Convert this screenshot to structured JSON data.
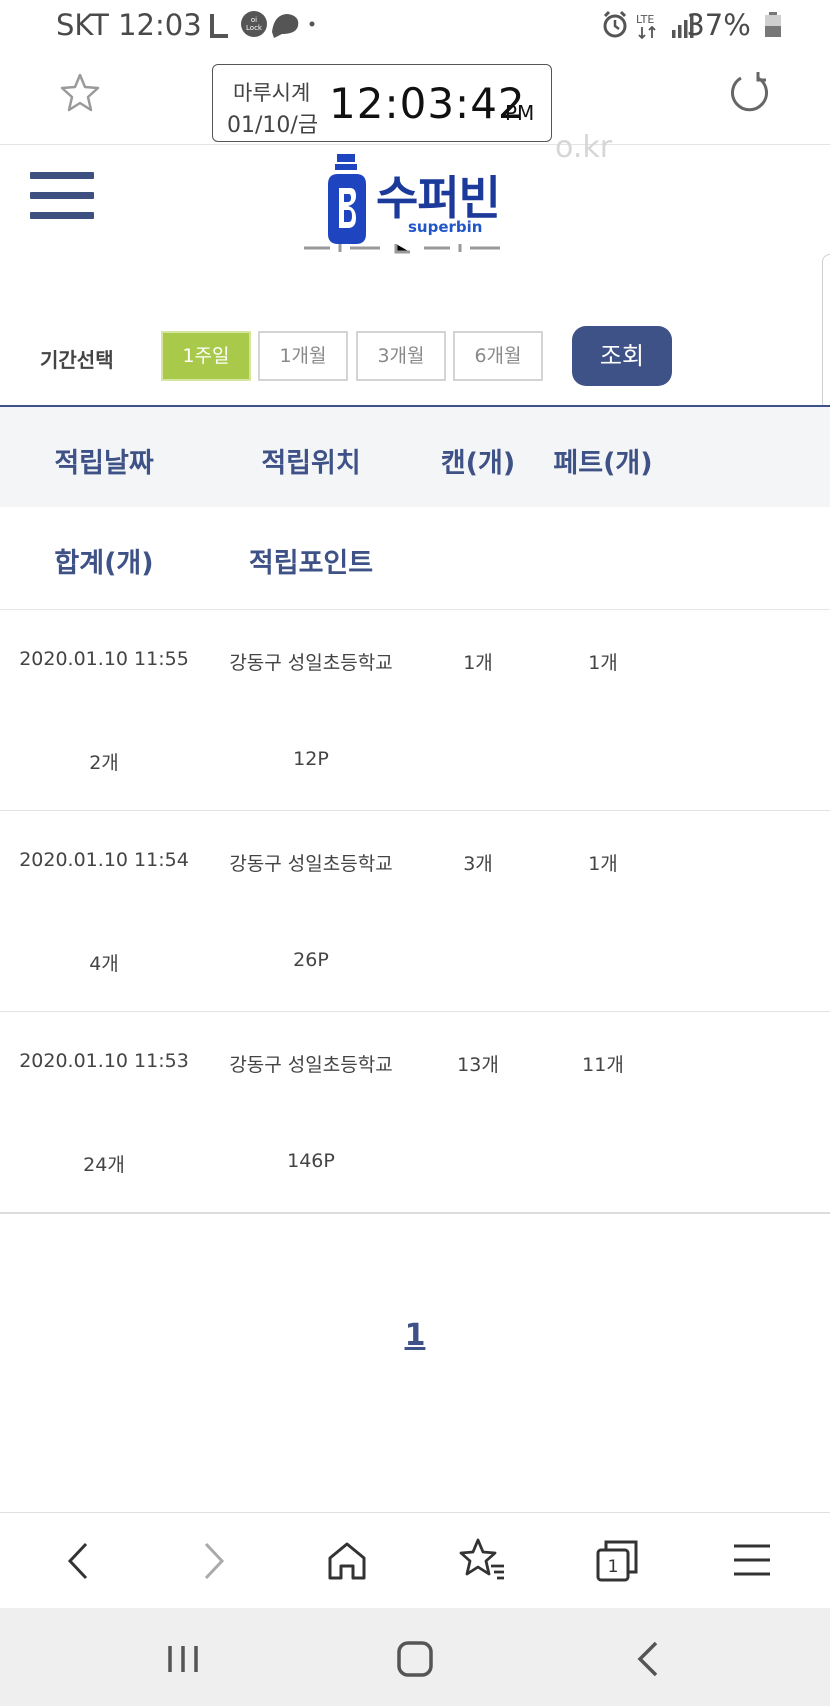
{
  "status_bar": {
    "carrier_time": "SKT 12:03",
    "network": "LTE",
    "battery": "37%"
  },
  "browser": {
    "clock_widget": {
      "name": "마루시계",
      "date": "01/10/금",
      "time": "12:03:42",
      "ampm": "PM"
    },
    "url_fragment": "o.kr"
  },
  "header": {
    "logo_text": "수퍼빈",
    "logo_sub": "superbin"
  },
  "filter": {
    "label": "기간선택",
    "periods": [
      "1주일",
      "1개월",
      "3개월",
      "6개월"
    ],
    "search_label": "조회"
  },
  "table": {
    "headers_row1": [
      "적립날짜",
      "적립위치",
      "캔(개)",
      "페트(개)"
    ],
    "headers_row2": [
      "합계(개)",
      "적립포인트"
    ],
    "rows": [
      {
        "date": "2020.01.10 11:55",
        "location": "강동구 성일초등학교",
        "can": "1개",
        "pet": "1개",
        "total": "2개",
        "points": "12P"
      },
      {
        "date": "2020.01.10 11:54",
        "location": "강동구 성일초등학교",
        "can": "3개",
        "pet": "1개",
        "total": "4개",
        "points": "26P"
      },
      {
        "date": "2020.01.10 11:53",
        "location": "강동구 성일초등학교",
        "can": "13개",
        "pet": "11개",
        "total": "24개",
        "points": "146P"
      }
    ]
  },
  "pagination": {
    "current": "1"
  },
  "browser_nav": {
    "tab_count": "1"
  },
  "colors": {
    "brand_navy": "#3e5287",
    "active_green": "#a9c94a",
    "logo_blue": "#1b3a9a"
  }
}
